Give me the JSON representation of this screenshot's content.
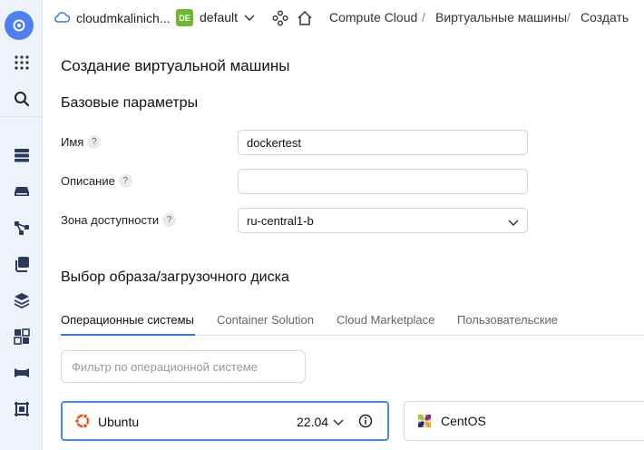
{
  "header": {
    "cloud_name": "cloudmkalinich...",
    "folder_badge": "DE",
    "folder_name": "default",
    "breadcrumbs": [
      "Compute Cloud",
      "Виртуальные машины",
      "Создать"
    ],
    "breadcrumb_separator": "/"
  },
  "sidebar": {
    "icons": [
      "home-icon",
      "apps-grid-icon",
      "search-icon",
      "server-list-icon",
      "disk-icon",
      "network-icon",
      "copy-icon",
      "layers-icon",
      "placement-icon",
      "gpu-icon",
      "frame-icon"
    ]
  },
  "page": {
    "title": "Создание виртуальной машины",
    "basic_section": "Базовые параметры",
    "help_glyph": "?",
    "fields": {
      "name_label": "Имя",
      "name_value": "dockertest",
      "description_label": "Описание",
      "description_value": "",
      "zone_label": "Зона доступности",
      "zone_value": "ru-central1-b"
    },
    "image_section": "Выбор образа/загрузочного диска",
    "tabs": [
      "Операционные системы",
      "Container Solution",
      "Cloud Marketplace",
      "Пользовательские"
    ],
    "active_tab": "Операционные системы",
    "filter_placeholder": "Фильтр по операционной системе",
    "os_cards": [
      {
        "name": "Ubuntu",
        "version": "22.04",
        "selected": true
      },
      {
        "name": "CentOS",
        "selected": false
      }
    ]
  },
  "colors": {
    "accent": "#3f74e8",
    "folder_badge": "#6dba2f",
    "rail_background": "#eef2fb"
  }
}
